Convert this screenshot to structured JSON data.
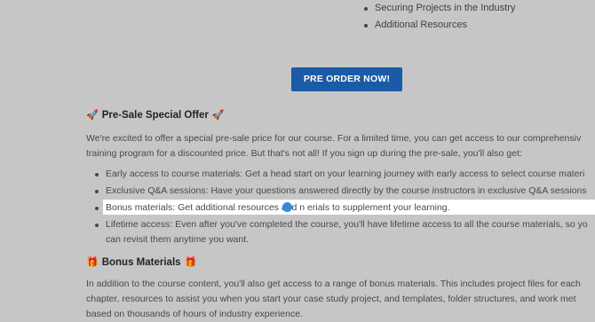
{
  "top_list": [
    "Securing Projects in the Industry",
    "Additional Resources"
  ],
  "cta": {
    "label": "PRE ORDER NOW!"
  },
  "presale": {
    "icon": "rocket-icon",
    "title": "Pre-Sale Special Offer",
    "para_line1": "We're excited to offer a special pre-sale price for our course. For a limited time, you can get access to our comprehensiv",
    "para_line2": "training program for a discounted price. But that's not all! If you sign up during the pre-sale, you'll also get:",
    "bullets": [
      "Early access to course materials: Get a head start on your learning journey with early access to select course materi",
      "Exclusive Q&A sessions: Have your questions answered directly by the course instructors in exclusive Q&A sessions",
      "Bonus materials: Get additional resources and n  erials to supplement your learning.",
      "Lifetime access: Even after you've completed the course, you'll have lifetime access to all the course materials, so yo"
    ],
    "bullet4_line2": "can revisit them anytime you want."
  },
  "bonus": {
    "icon": "gift-icon",
    "title": "Bonus Materials",
    "para_line1": "In addition to the course content, you'll also get access to a range of bonus materials. This includes project files for each",
    "para_line2": "chapter, resources to assist you when you start your case study project, and templates, folder structures, and work met",
    "para_line3": "based on thousands of hours of industry experience."
  }
}
